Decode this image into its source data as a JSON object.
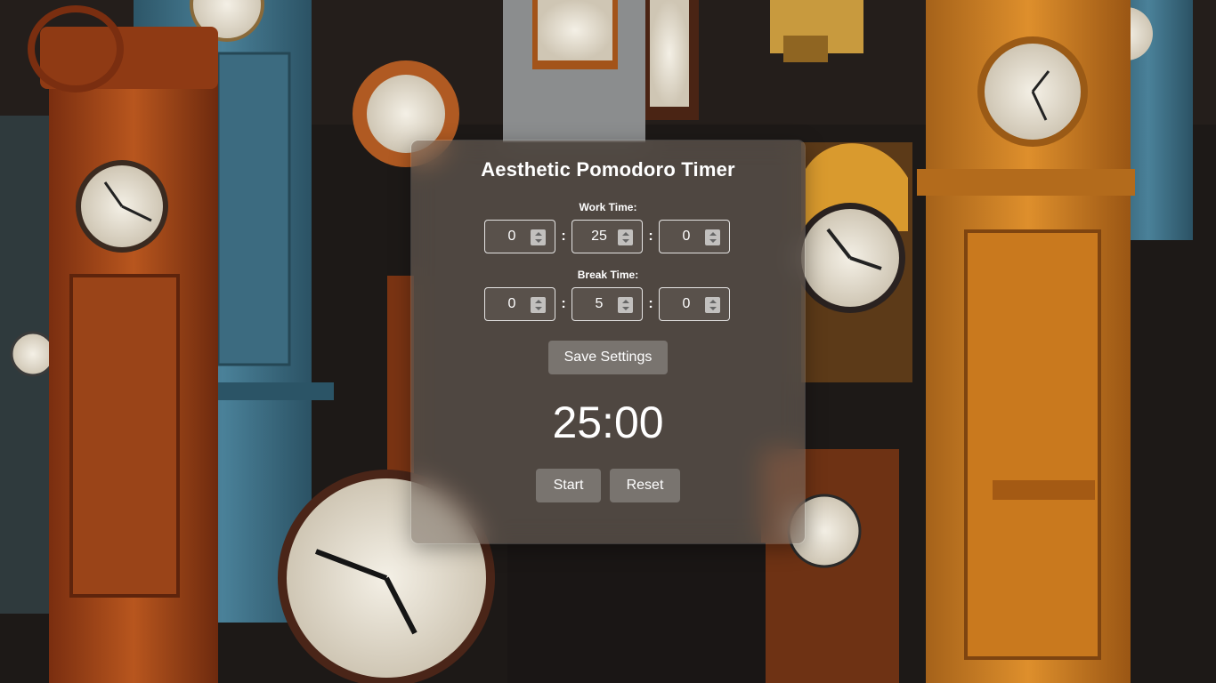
{
  "title": "Aesthetic Pomodoro Timer",
  "work": {
    "label": "Work Time:",
    "hours": "0",
    "minutes": "25",
    "seconds": "0"
  },
  "break": {
    "label": "Break Time:",
    "hours": "0",
    "minutes": "5",
    "seconds": "0"
  },
  "separator": ":",
  "save_label": "Save Settings",
  "timer_display": "25:00",
  "start_label": "Start",
  "reset_label": "Reset",
  "colors": {
    "panel": "#786e64",
    "wood": "#b5561f",
    "blue_wood": "#3f6f86",
    "face": "#ece6da"
  }
}
